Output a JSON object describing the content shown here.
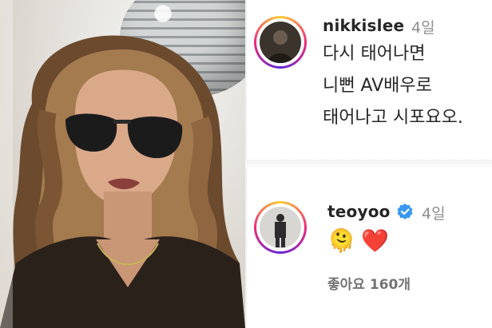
{
  "photo": {
    "description_icon": "portrait-photo"
  },
  "comment1": {
    "username": "nikkislee",
    "time": "4일",
    "lines": [
      "다시 태어나면",
      "니뻔 AV배우로",
      "태어나고 시포요오."
    ]
  },
  "comment2": {
    "username": "teoyoo",
    "time": "4일",
    "emojis": [
      "🫠",
      "❤️"
    ],
    "likes": "좋아요 160개"
  },
  "colors": {
    "heart": "#e0245e",
    "verified": "#3897f0",
    "muted": "#8e8e8e"
  }
}
